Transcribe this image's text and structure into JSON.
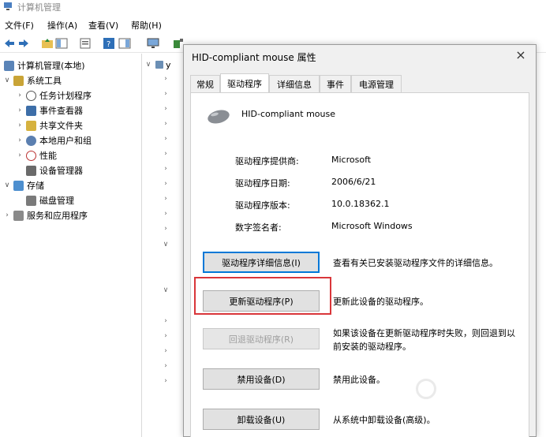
{
  "window": {
    "title": "计算机管理"
  },
  "menu": {
    "items": [
      "文件(F)",
      "操作(A)",
      "查看(V)",
      "帮助(H)"
    ]
  },
  "toolbar": {
    "icons": [
      "back-arrow-icon",
      "forward-arrow-icon",
      "up-folder-icon",
      "show-tree-icon",
      "properties-icon",
      "help-icon",
      "console-icon",
      "monitor-icon",
      "scan-hardware-icon",
      "uninstall-x-icon",
      "download-icon"
    ]
  },
  "tree": {
    "root": "计算机管理(本地)",
    "items": [
      {
        "label": "系统工具",
        "icon": "tools-icon"
      },
      {
        "label": "任务计划程序",
        "icon": "clock-icon"
      },
      {
        "label": "事件查看器",
        "icon": "event-viewer-icon"
      },
      {
        "label": "共享文件夹",
        "icon": "shared-folder-icon"
      },
      {
        "label": "本地用户和组",
        "icon": "users-icon"
      },
      {
        "label": "性能",
        "icon": "performance-icon"
      },
      {
        "label": "设备管理器",
        "icon": "device-manager-icon"
      },
      {
        "label": "存储",
        "icon": "storage-icon"
      },
      {
        "label": "磁盘管理",
        "icon": "disk-icon"
      },
      {
        "label": "服务和应用程序",
        "icon": "services-icon"
      }
    ]
  },
  "devlist": {
    "top_label": "y"
  },
  "dialog": {
    "title": "HID-compliant mouse 属性",
    "close": "×",
    "tabs": [
      "常规",
      "驱动程序",
      "详细信息",
      "事件",
      "电源管理"
    ],
    "active_tab": "驱动程序",
    "device_name": "HID-compliant mouse",
    "properties": [
      {
        "label": "驱动程序提供商:",
        "value": "Microsoft"
      },
      {
        "label": "驱动程序日期:",
        "value": "2006/6/21"
      },
      {
        "label": "驱动程序版本:",
        "value": "10.0.18362.1"
      },
      {
        "label": "数字签名者:",
        "value": "Microsoft Windows"
      }
    ],
    "buttons": [
      {
        "label": "驱动程序详细信息(I)",
        "desc": "查看有关已安装驱动程序文件的详细信息。"
      },
      {
        "label": "更新驱动程序(P)",
        "desc": "更新此设备的驱动程序。"
      },
      {
        "label": "回退驱动程序(R)",
        "desc": "如果该设备在更新驱动程序时失败，则回退到以前安装的驱动程序。"
      },
      {
        "label": "禁用设备(D)",
        "desc": "禁用此设备。"
      },
      {
        "label": "卸载设备(U)",
        "desc": "从系统中卸载设备(高级)。"
      }
    ]
  },
  "colors": {
    "highlight": "#d9363a",
    "focus": "#0078d7"
  }
}
